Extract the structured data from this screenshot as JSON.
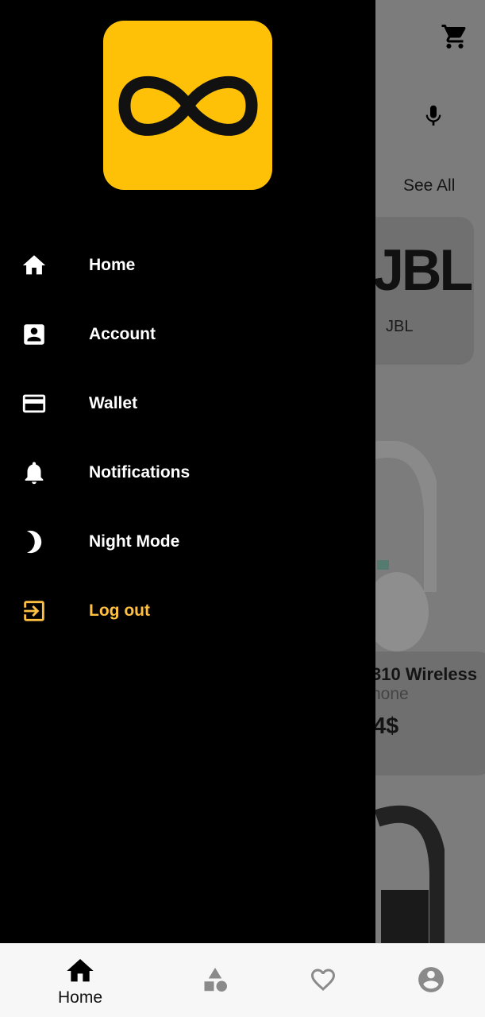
{
  "background": {
    "see_all": "See All",
    "brand": {
      "logo_text": "JBL",
      "name": "JBL"
    },
    "product": {
      "name": "310 Wireless",
      "subtitle": "hone",
      "price": "4$"
    },
    "icons": [
      "cart-icon",
      "microphone-icon"
    ]
  },
  "drawer": {
    "logo_color": "#FFC107",
    "accent_color": "#FFC041",
    "items": [
      {
        "label": "Home",
        "icon": "home-icon"
      },
      {
        "label": "Account",
        "icon": "account-box-icon"
      },
      {
        "label": "Wallet",
        "icon": "credit-card-icon"
      },
      {
        "label": "Notifications",
        "icon": "bell-icon"
      },
      {
        "label": "Night Mode",
        "icon": "moon-icon"
      },
      {
        "label": "Log out",
        "icon": "logout-icon"
      }
    ]
  },
  "bottom_nav": {
    "items": [
      {
        "label": "Home",
        "icon": "home-icon",
        "active": true
      },
      {
        "label": "",
        "icon": "shapes-icon"
      },
      {
        "label": "",
        "icon": "heart-icon"
      },
      {
        "label": "",
        "icon": "profile-icon"
      }
    ]
  }
}
